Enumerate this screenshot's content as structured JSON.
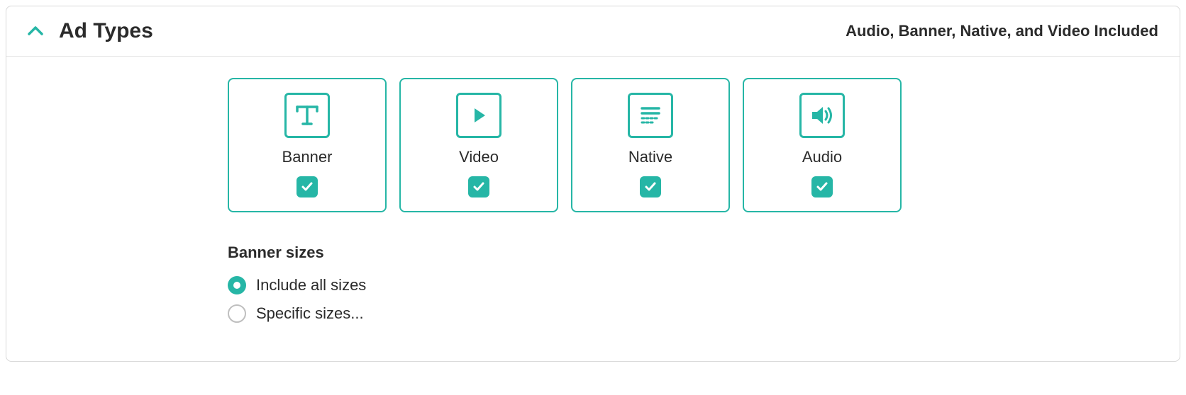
{
  "colors": {
    "accent": "#26b6a6",
    "text": "#2b2b2b",
    "border": "#d8d8d8"
  },
  "panel": {
    "title": "Ad Types",
    "summary": "Audio, Banner, Native, and Video Included"
  },
  "adTypes": [
    {
      "label": "Banner",
      "icon": "text-icon",
      "checked": true
    },
    {
      "label": "Video",
      "icon": "play-icon",
      "checked": true
    },
    {
      "label": "Native",
      "icon": "native-icon",
      "checked": true
    },
    {
      "label": "Audio",
      "icon": "audio-icon",
      "checked": true
    }
  ],
  "bannerSizes": {
    "title": "Banner sizes",
    "options": [
      {
        "label": "Include all sizes",
        "selected": true
      },
      {
        "label": "Specific sizes...",
        "selected": false
      }
    ]
  }
}
